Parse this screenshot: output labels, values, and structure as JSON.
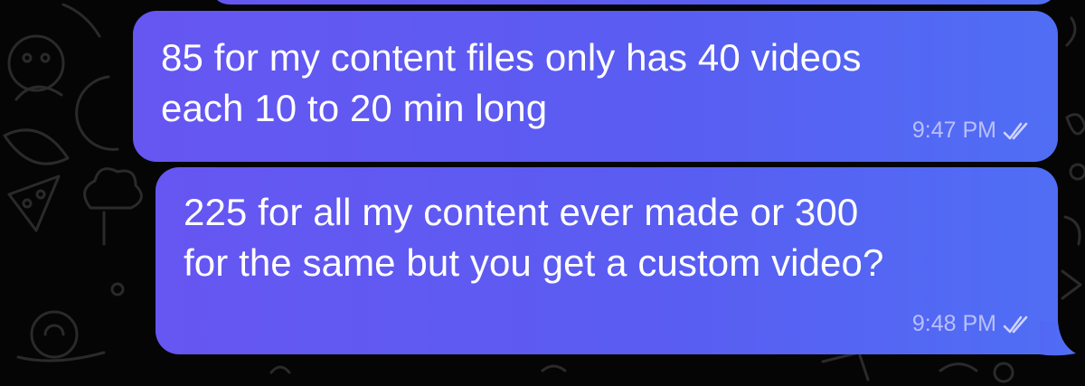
{
  "messages": [
    {
      "text": "85 for my content files only has 40 videos\neach 10 to 20 min long",
      "time": "9:47 PM",
      "status_icon": "double-check-icon"
    },
    {
      "text": "225 for all my content ever made or 300\nfor the same but you get a custom video?",
      "time": "9:48 PM",
      "status_icon": "double-check-icon"
    }
  ],
  "colors": {
    "background": "#050505",
    "bubble_gradient_start": "#6656f2",
    "bubble_gradient_end": "#4f6ef4",
    "message_text": "#ffffff",
    "doodle_stroke": "#2a2a2c"
  }
}
